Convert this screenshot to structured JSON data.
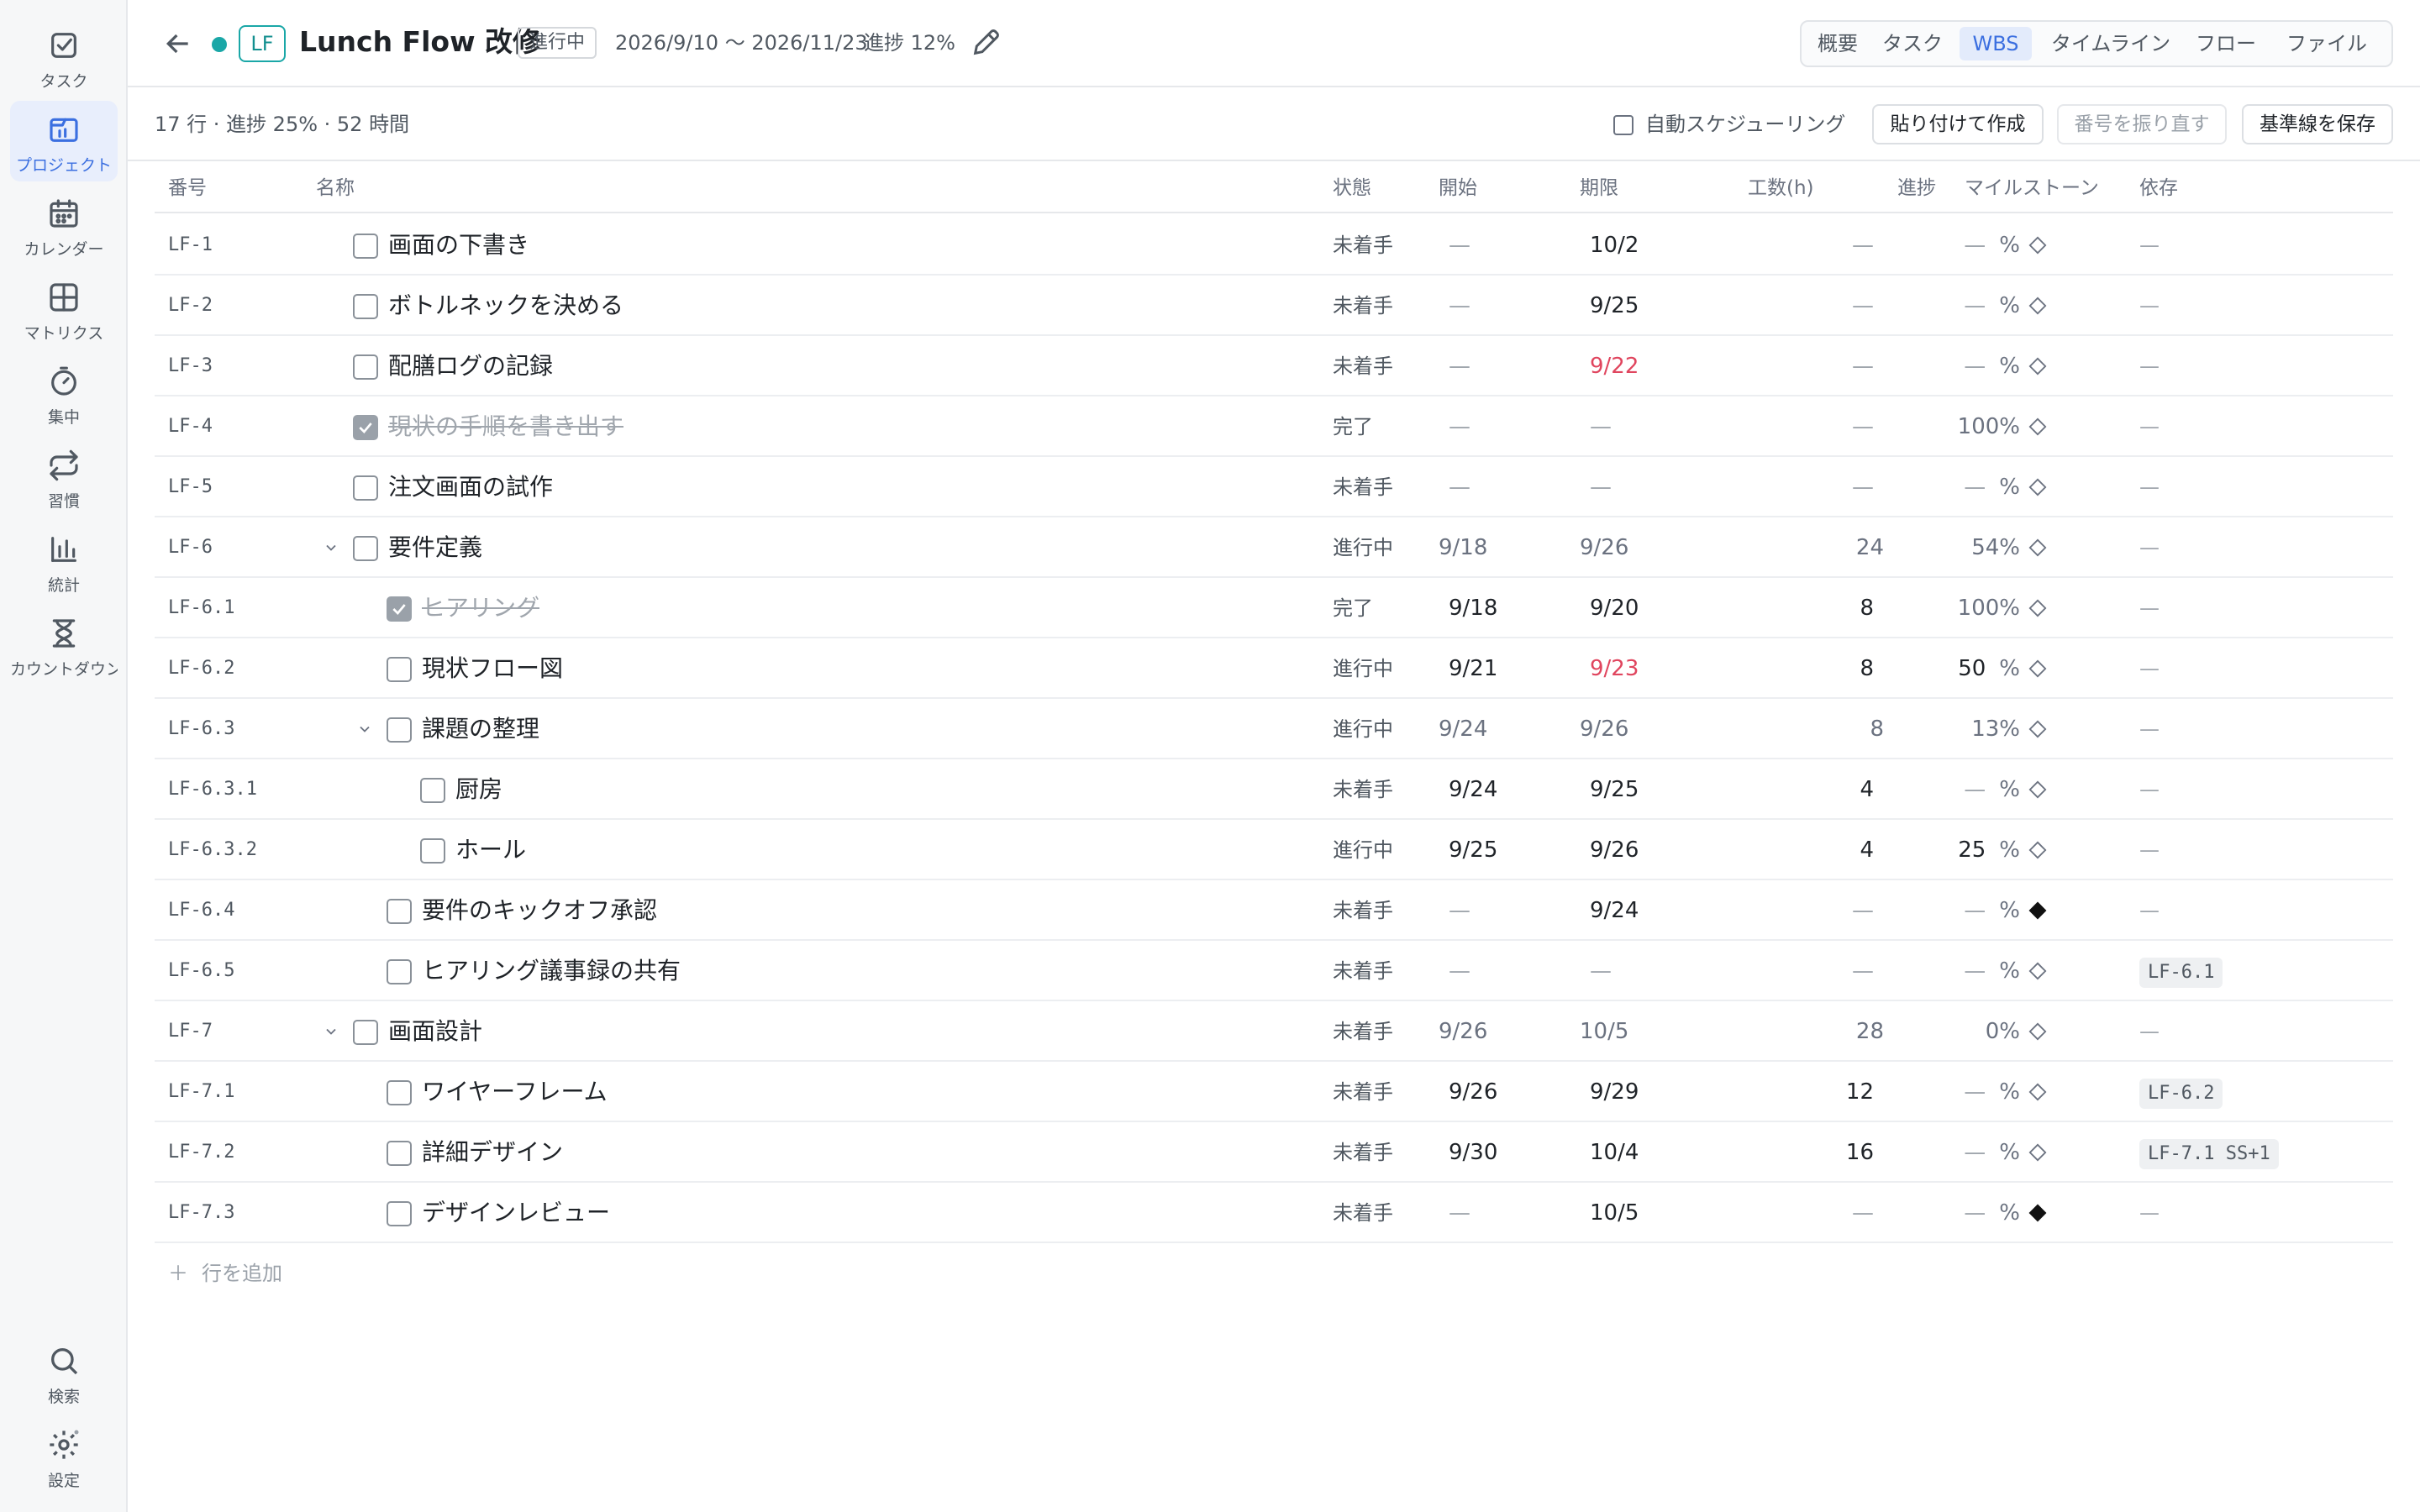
{
  "sidebar": {
    "items": [
      {
        "label": "タスク",
        "icon": "task-check-icon",
        "active": false
      },
      {
        "label": "プロジェクト",
        "icon": "project-icon",
        "active": true
      },
      {
        "label": "カレンダー",
        "icon": "calendar-icon",
        "active": false
      },
      {
        "label": "マトリクス",
        "icon": "matrix-icon",
        "active": false
      },
      {
        "label": "集中",
        "icon": "timer-icon",
        "active": false
      },
      {
        "label": "習慣",
        "icon": "repeat-icon",
        "active": false
      },
      {
        "label": "統計",
        "icon": "bar-chart-icon",
        "active": false
      },
      {
        "label": "カウントダウン",
        "icon": "hourglass-icon",
        "active": false
      }
    ],
    "bottom": [
      {
        "label": "検索",
        "icon": "search-icon"
      },
      {
        "label": "設定",
        "icon": "gear-icon"
      }
    ]
  },
  "header": {
    "code": "LF",
    "title": "Lunch Flow 改修",
    "status": "進行中",
    "dates": "2026/9/10 〜 2026/11/23",
    "progress": "進捗 12%",
    "accent_color": "#1aa7a7",
    "tabs": [
      {
        "label": "概要",
        "active": false
      },
      {
        "label": "タスク",
        "active": false
      },
      {
        "label": "WBS",
        "active": true
      },
      {
        "label": "タイムライン",
        "active": false
      },
      {
        "label": "フロー",
        "active": false
      },
      {
        "label": "ファイル",
        "active": false
      }
    ]
  },
  "toolbar": {
    "summary": "17 行 · 進捗 25% · 52 時間",
    "auto_schedule_label": "自動スケジューリング",
    "paste_create_label": "貼り付けて作成",
    "renumber_label": "番号を振り直す",
    "save_baseline_label": "基準線を保存"
  },
  "table": {
    "columns": {
      "id": "番号",
      "name": "名称",
      "status": "状態",
      "start": "開始",
      "due": "期限",
      "hours": "工数(h)",
      "progress": "進捗",
      "milestone": "マイルストーン",
      "dependency": "依存"
    },
    "dash": "—",
    "pct": "%",
    "rows": [
      {
        "id": "LF-1",
        "level": 0,
        "name": "画面の下書き",
        "status": "未着手",
        "start": "—",
        "due": "10/2",
        "hours": "—",
        "progress": "—",
        "milestone": false,
        "dependency": "—",
        "done": false,
        "parent": false,
        "overdue": false
      },
      {
        "id": "LF-2",
        "level": 0,
        "name": "ボトルネックを決める",
        "status": "未着手",
        "start": "—",
        "due": "9/25",
        "hours": "—",
        "progress": "—",
        "milestone": false,
        "dependency": "—",
        "done": false,
        "parent": false,
        "overdue": false
      },
      {
        "id": "LF-3",
        "level": 0,
        "name": "配膳ログの記録",
        "status": "未着手",
        "start": "—",
        "due": "9/22",
        "hours": "—",
        "progress": "—",
        "milestone": false,
        "dependency": "—",
        "done": false,
        "parent": false,
        "overdue": true
      },
      {
        "id": "LF-4",
        "level": 0,
        "name": "現状の手順を書き出す",
        "status": "完了",
        "start": "—",
        "due": "—",
        "hours": "—",
        "progress": "100%",
        "milestone": false,
        "dependency": "—",
        "done": true,
        "parent": false,
        "overdue": false
      },
      {
        "id": "LF-5",
        "level": 0,
        "name": "注文画面の試作",
        "status": "未着手",
        "start": "—",
        "due": "—",
        "hours": "—",
        "progress": "—",
        "milestone": false,
        "dependency": "—",
        "done": false,
        "parent": false,
        "overdue": false
      },
      {
        "id": "LF-6",
        "level": 0,
        "name": "要件定義",
        "status": "進行中",
        "start": "9/18",
        "due": "9/26",
        "hours": "24",
        "progress": "54%",
        "milestone": false,
        "dependency": "—",
        "done": false,
        "parent": true,
        "overdue": false
      },
      {
        "id": "LF-6.1",
        "level": 1,
        "name": "ヒアリング",
        "status": "完了",
        "start": "9/18",
        "due": "9/20",
        "hours": "8",
        "progress": "100%",
        "milestone": false,
        "dependency": "—",
        "done": true,
        "parent": false,
        "overdue": false
      },
      {
        "id": "LF-6.2",
        "level": 1,
        "name": "現状フロー図",
        "status": "進行中",
        "start": "9/21",
        "due": "9/23",
        "hours": "8",
        "progress": "50",
        "milestone": false,
        "dependency": "—",
        "done": false,
        "parent": false,
        "overdue": true
      },
      {
        "id": "LF-6.3",
        "level": 1,
        "name": "課題の整理",
        "status": "進行中",
        "start": "9/24",
        "due": "9/26",
        "hours": "8",
        "progress": "13%",
        "milestone": false,
        "dependency": "—",
        "done": false,
        "parent": true,
        "overdue": false
      },
      {
        "id": "LF-6.3.1",
        "level": 2,
        "name": "厨房",
        "status": "未着手",
        "start": "9/24",
        "due": "9/25",
        "hours": "4",
        "progress": "—",
        "milestone": false,
        "dependency": "—",
        "done": false,
        "parent": false,
        "overdue": false
      },
      {
        "id": "LF-6.3.2",
        "level": 2,
        "name": "ホール",
        "status": "進行中",
        "start": "9/25",
        "due": "9/26",
        "hours": "4",
        "progress": "25",
        "milestone": false,
        "dependency": "—",
        "done": false,
        "parent": false,
        "overdue": false
      },
      {
        "id": "LF-6.4",
        "level": 1,
        "name": "要件のキックオフ承認",
        "status": "未着手",
        "start": "—",
        "due": "9/24",
        "hours": "—",
        "progress": "—",
        "milestone": true,
        "dependency": "—",
        "done": false,
        "parent": false,
        "overdue": false
      },
      {
        "id": "LF-6.5",
        "level": 1,
        "name": "ヒアリング議事録の共有",
        "status": "未着手",
        "start": "—",
        "due": "—",
        "hours": "—",
        "progress": "—",
        "milestone": false,
        "dependency": "LF-6.1",
        "done": false,
        "parent": false,
        "overdue": false
      },
      {
        "id": "LF-7",
        "level": 0,
        "name": "画面設計",
        "status": "未着手",
        "start": "9/26",
        "due": "10/5",
        "hours": "28",
        "progress": "0%",
        "milestone": false,
        "dependency": "—",
        "done": false,
        "parent": true,
        "overdue": false
      },
      {
        "id": "LF-7.1",
        "level": 1,
        "name": "ワイヤーフレーム",
        "status": "未着手",
        "start": "9/26",
        "due": "9/29",
        "hours": "12",
        "progress": "—",
        "milestone": false,
        "dependency": "LF-6.2",
        "done": false,
        "parent": false,
        "overdue": false
      },
      {
        "id": "LF-7.2",
        "level": 1,
        "name": "詳細デザイン",
        "status": "未着手",
        "start": "9/30",
        "due": "10/4",
        "hours": "16",
        "progress": "—",
        "milestone": false,
        "dependency": "LF-7.1 SS+1",
        "done": false,
        "parent": false,
        "overdue": false
      },
      {
        "id": "LF-7.3",
        "level": 1,
        "name": "デザインレビュー",
        "status": "未着手",
        "start": "—",
        "due": "10/5",
        "hours": "—",
        "progress": "—",
        "milestone": true,
        "dependency": "—",
        "done": false,
        "parent": false,
        "overdue": false
      }
    ]
  },
  "add_row_label": "行を追加"
}
